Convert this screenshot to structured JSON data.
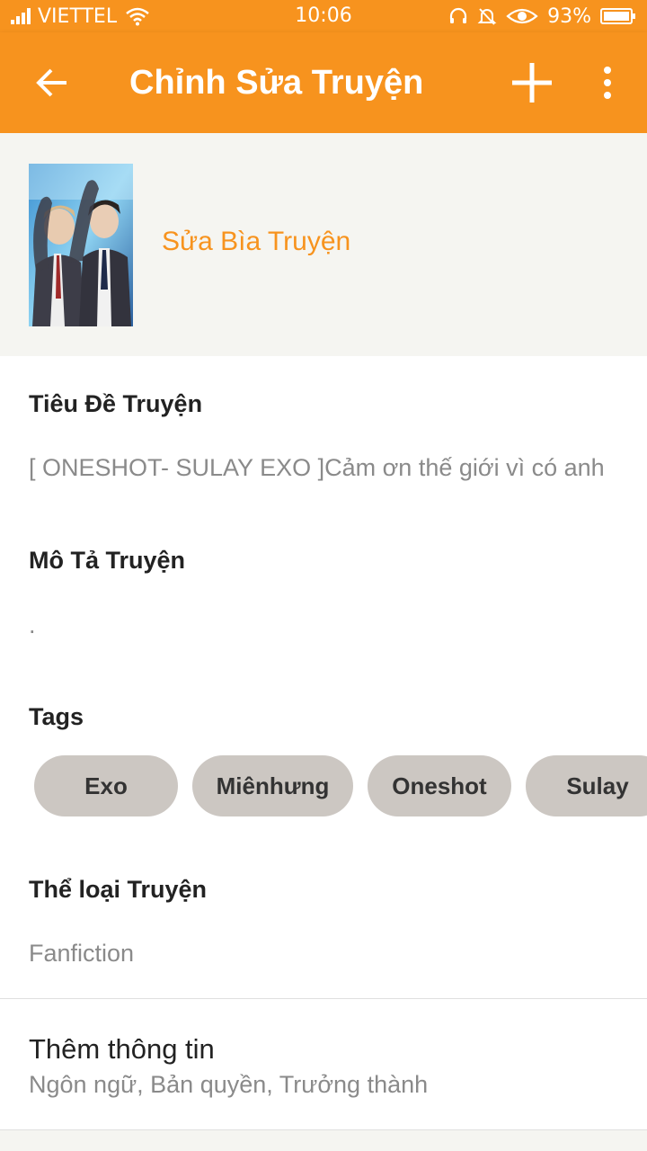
{
  "status_bar": {
    "carrier": "VIETTEL",
    "time": "10:06",
    "battery": "93%",
    "icons": [
      "signal-icon",
      "wifi-icon",
      "headset-icon",
      "bell-off-icon",
      "eye-icon",
      "battery-icon"
    ]
  },
  "app_bar": {
    "title": "Chỉnh Sửa Truyện",
    "icons": [
      "back-arrow-icon",
      "plus-icon",
      "more-vert-icon"
    ]
  },
  "cover": {
    "edit_label": "Sửa Bìa Truyện"
  },
  "story": {
    "title_label": "Tiêu Đề Truyện",
    "title_value": "[ ONESHOT- SULAY EXO ]Cảm ơn thế giới vì có anh",
    "description_label": "Mô Tả Truyện",
    "description_value": ".",
    "tags_label": "Tags",
    "tags": [
      "Exo",
      "Miênhưng",
      "Oneshot",
      "Sulay"
    ],
    "genre_label": "Thể loại Truyện",
    "genre_value": "Fanfiction"
  },
  "more_info": {
    "title": "Thêm thông tin",
    "subtitle": "Ngôn ngữ, Bản quyền, Trưởng thành"
  },
  "colors": {
    "accent": "#f7931e",
    "tag_bg": "#ccc7c2",
    "page_bg": "#f5f5f1"
  }
}
